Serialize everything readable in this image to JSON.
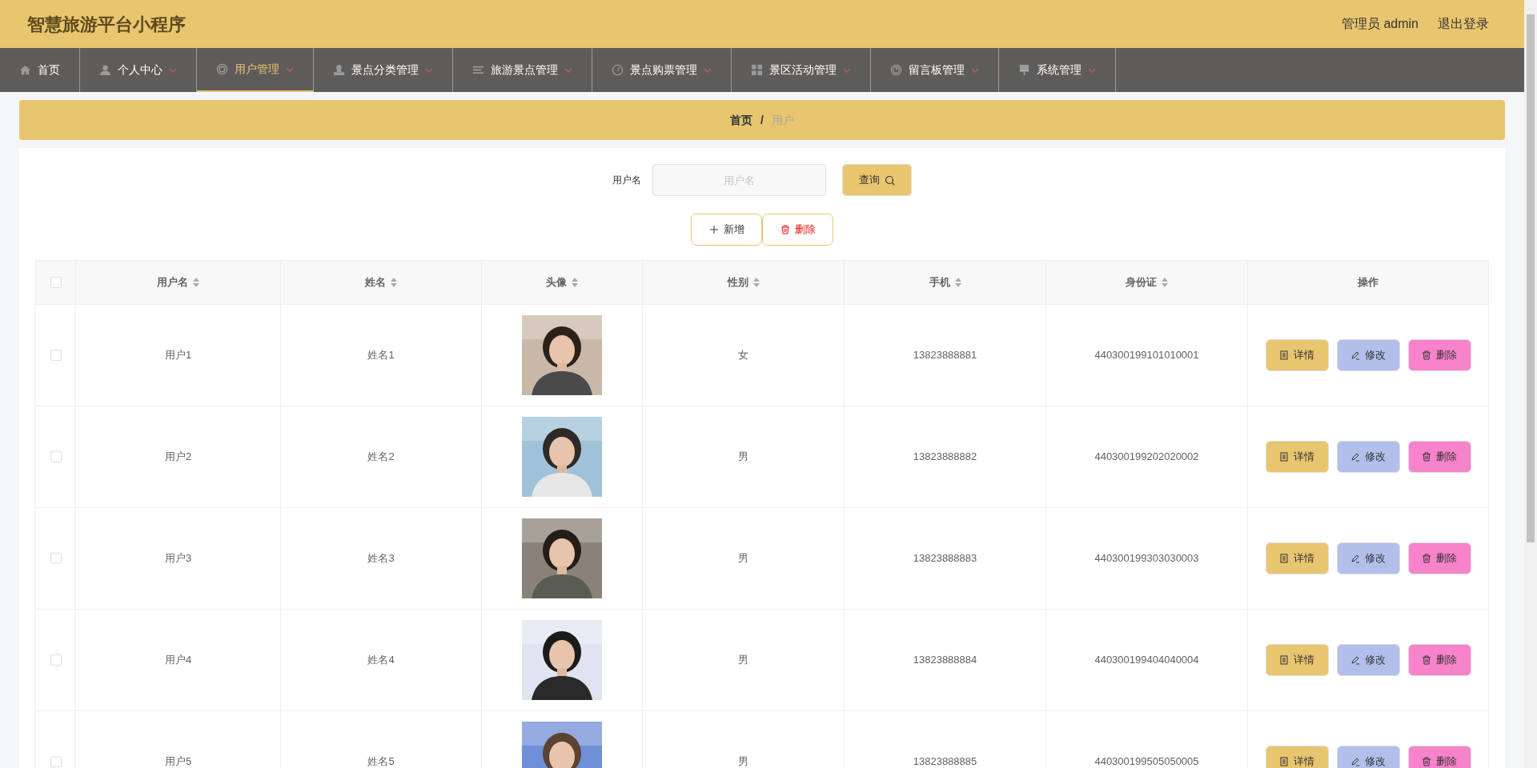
{
  "header": {
    "title": "智慧旅游平台小程序",
    "user": "管理员 admin",
    "logout": "退出登录"
  },
  "nav": [
    {
      "label": "首页",
      "selected": false,
      "has_menu": false
    },
    {
      "label": "个人中心",
      "selected": false,
      "has_menu": true
    },
    {
      "label": "用户管理",
      "selected": true,
      "has_menu": true
    },
    {
      "label": "景点分类管理",
      "selected": false,
      "has_menu": true
    },
    {
      "label": "旅游景点管理",
      "selected": false,
      "has_menu": true
    },
    {
      "label": "景点购票管理",
      "selected": false,
      "has_menu": true
    },
    {
      "label": "景区活动管理",
      "selected": false,
      "has_menu": true
    },
    {
      "label": "留言板管理",
      "selected": false,
      "has_menu": true
    },
    {
      "label": "系统管理",
      "selected": false,
      "has_menu": true
    }
  ],
  "breadcrumb": [
    {
      "label": "首页"
    },
    {
      "label": "用户"
    }
  ],
  "breadcrumb_separator": "/",
  "search": {
    "label": "用户名",
    "placeholder": "用户名",
    "button": "查询"
  },
  "actions": [
    {
      "kind": "add",
      "label": "新增"
    },
    {
      "kind": "delete",
      "label": "删除"
    }
  ],
  "table": {
    "select_all_checked": false,
    "columns": [
      {
        "label": "用户名",
        "sortable": true
      },
      {
        "label": "姓名",
        "sortable": true
      },
      {
        "label": "头像",
        "sortable": true
      },
      {
        "label": "性别",
        "sortable": true
      },
      {
        "label": "手机",
        "sortable": true
      },
      {
        "label": "身份证",
        "sortable": true
      },
      {
        "label": "操作",
        "sortable": false
      }
    ],
    "rows": [
      {
        "checked": false,
        "username": "用户1",
        "name": "姓名1",
        "gender": "女",
        "phone": "13823888881",
        "id_card": "440300199101010001",
        "buttons": [
          {
            "kind": "detail",
            "label": "详情"
          },
          {
            "kind": "edit",
            "label": "修改"
          },
          {
            "kind": "delete",
            "label": "删除"
          }
        ]
      },
      {
        "checked": false,
        "username": "用户2",
        "name": "姓名2",
        "gender": "男",
        "phone": "13823888882",
        "id_card": "440300199202020002",
        "buttons": [
          {
            "kind": "detail",
            "label": "详情"
          },
          {
            "kind": "edit",
            "label": "修改"
          },
          {
            "kind": "delete",
            "label": "删除"
          }
        ]
      },
      {
        "checked": false,
        "username": "用户3",
        "name": "姓名3",
        "gender": "男",
        "phone": "13823888883",
        "id_card": "440300199303030003",
        "buttons": [
          {
            "kind": "detail",
            "label": "详情"
          },
          {
            "kind": "edit",
            "label": "修改"
          },
          {
            "kind": "delete",
            "label": "删除"
          }
        ]
      },
      {
        "checked": false,
        "username": "用户4",
        "name": "姓名4",
        "gender": "男",
        "phone": "13823888884",
        "id_card": "440300199404040004",
        "buttons": [
          {
            "kind": "detail",
            "label": "详情"
          },
          {
            "kind": "edit",
            "label": "修改"
          },
          {
            "kind": "delete",
            "label": "删除"
          }
        ]
      },
      {
        "checked": false,
        "username": "用户5",
        "name": "姓名5",
        "gender": "男",
        "phone": "13823888885",
        "id_card": "440300199505050005",
        "buttons": [
          {
            "kind": "detail",
            "label": "详情"
          },
          {
            "kind": "edit",
            "label": "修改"
          },
          {
            "kind": "delete",
            "label": "删除"
          }
        ]
      }
    ]
  }
}
